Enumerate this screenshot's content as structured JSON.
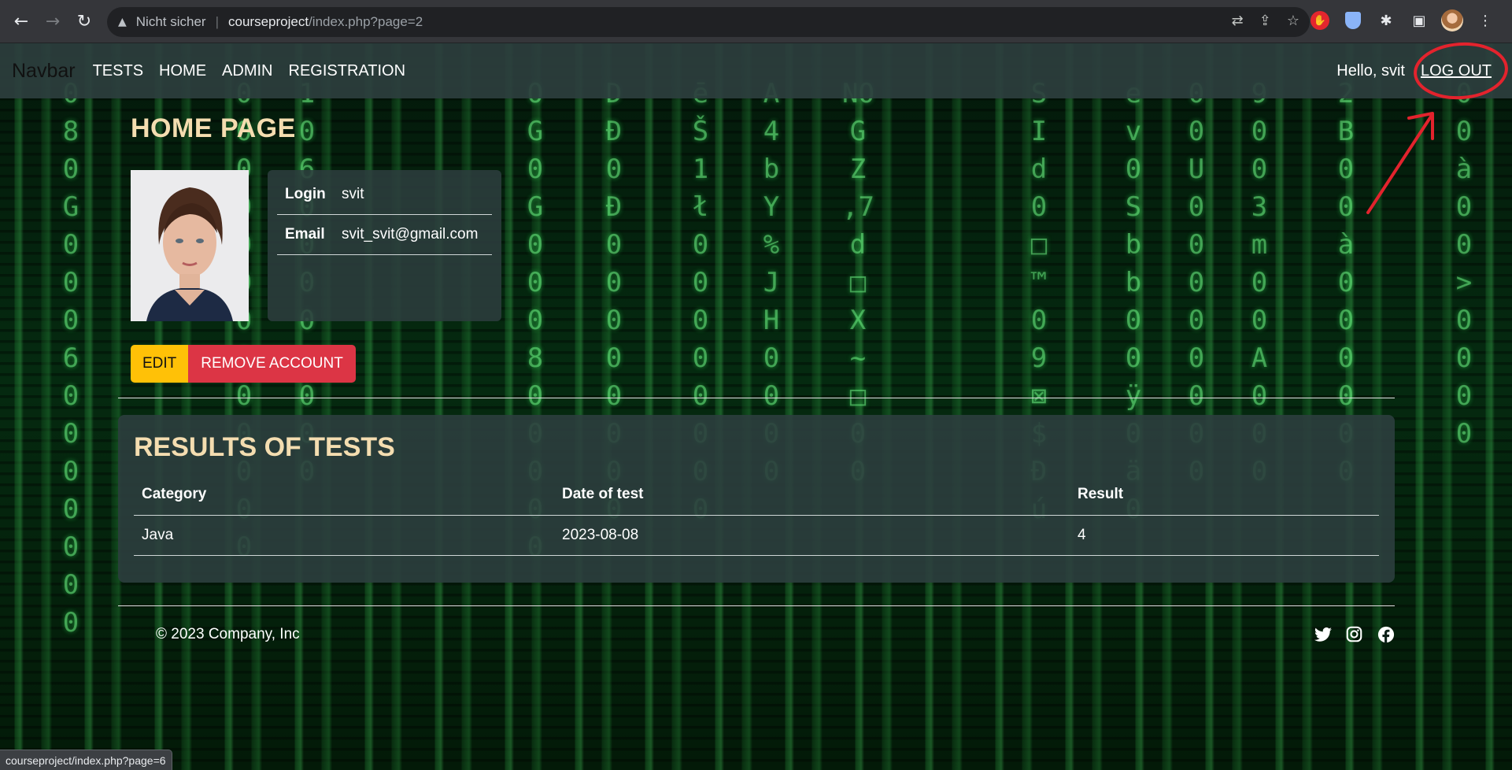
{
  "browser": {
    "security_label": "Nicht sicher",
    "url_host": "courseproject",
    "url_path": "/index.php?page=2",
    "status_url": "courseproject/index.php?page=6"
  },
  "navbar": {
    "brand": "Navbar",
    "links": [
      "TESTS",
      "HOME",
      "ADMIN",
      "REGISTRATION"
    ],
    "greeting": "Hello, svit",
    "logout": "LOG OUT"
  },
  "home": {
    "title": "HOME PAGE",
    "login_label": "Login",
    "login_value": "svit",
    "email_label": "Email",
    "email_value": "svit_svit@gmail.com",
    "edit_label": "EDIT",
    "remove_label": "REMOVE ACCOUNT"
  },
  "results": {
    "title": "RESULTS OF TESTS",
    "headers": [
      "Category",
      "Date of test",
      "Result"
    ],
    "rows": [
      [
        "Java",
        "2023-08-08",
        "4"
      ]
    ]
  },
  "footer": {
    "copyright": "© 2023 Company, Inc",
    "social": [
      "twitter-icon",
      "instagram-icon",
      "facebook-icon"
    ]
  },
  "colors": {
    "accent_title": "#f4ddb0",
    "edit_button": "#ffc107",
    "remove_button": "#dc3545",
    "annotation": "#e3232d"
  }
}
